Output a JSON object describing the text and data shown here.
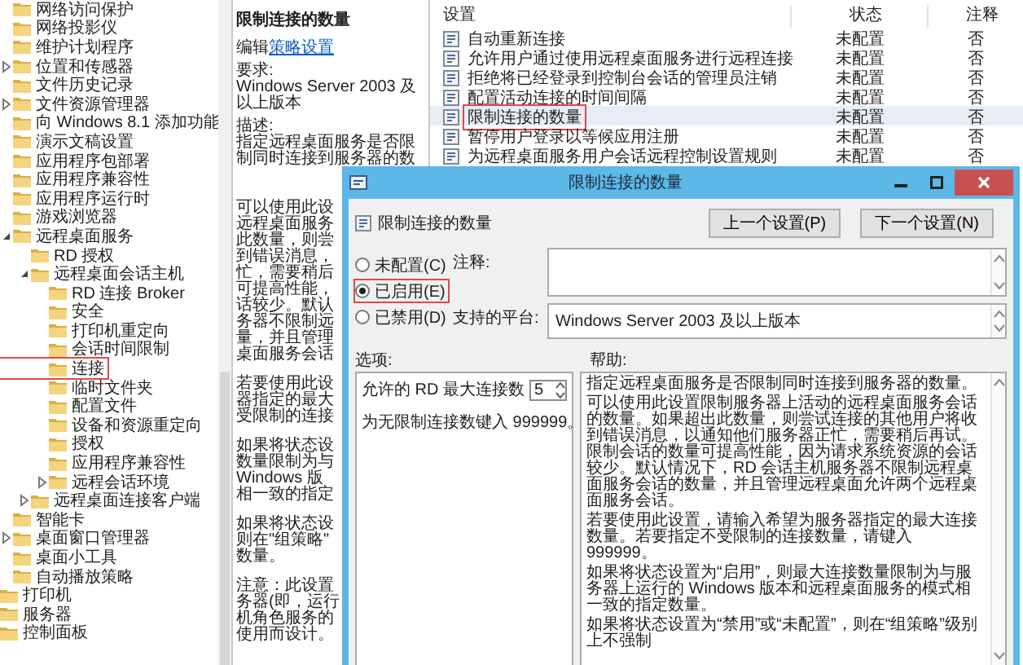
{
  "tree": {
    "items": [
      {
        "label": "网络访问保护",
        "kind": "leaf",
        "highlighted": false
      },
      {
        "label": "网络投影仪",
        "kind": "leaf",
        "highlighted": false
      },
      {
        "label": "维护计划程序",
        "kind": "leaf",
        "highlighted": false
      },
      {
        "label": "位置和传感器",
        "kind": "collapsed",
        "highlighted": false
      },
      {
        "label": "文件历史记录",
        "kind": "leaf",
        "highlighted": false
      },
      {
        "label": "文件资源管理器",
        "kind": "collapsed",
        "highlighted": false
      },
      {
        "label": "向 Windows 8.1 添加功能",
        "kind": "leaf",
        "highlighted": false
      },
      {
        "label": "演示文稿设置",
        "kind": "leaf",
        "highlighted": false
      },
      {
        "label": "应用程序包部署",
        "kind": "leaf",
        "highlighted": false
      },
      {
        "label": "应用程序兼容性",
        "kind": "leaf",
        "highlighted": false
      },
      {
        "label": "应用程序运行时",
        "kind": "leaf",
        "highlighted": false
      },
      {
        "label": "游戏浏览器",
        "kind": "leaf",
        "highlighted": false
      },
      {
        "label": "远程桌面服务",
        "kind": "expanded",
        "highlighted": false,
        "children": [
          {
            "label": "RD 授权",
            "kind": "leaf",
            "highlighted": false
          },
          {
            "label": "远程桌面会话主机",
            "kind": "expanded",
            "highlighted": false,
            "children": [
              {
                "label": "RD 连接 Broker",
                "kind": "leaf",
                "highlighted": false
              },
              {
                "label": "安全",
                "kind": "leaf",
                "highlighted": false
              },
              {
                "label": "打印机重定向",
                "kind": "leaf",
                "highlighted": false
              },
              {
                "label": "会话时间限制",
                "kind": "leaf",
                "highlighted": false
              },
              {
                "label": "连接",
                "kind": "leaf",
                "highlighted": true
              },
              {
                "label": "临时文件夹",
                "kind": "leaf",
                "highlighted": false
              },
              {
                "label": "配置文件",
                "kind": "leaf",
                "highlighted": false
              },
              {
                "label": "设备和资源重定向",
                "kind": "leaf",
                "highlighted": false
              },
              {
                "label": "授权",
                "kind": "leaf",
                "highlighted": false
              },
              {
                "label": "应用程序兼容性",
                "kind": "leaf",
                "highlighted": false
              },
              {
                "label": "远程会话环境",
                "kind": "collapsed",
                "highlighted": false
              }
            ]
          },
          {
            "label": "远程桌面连接客户端",
            "kind": "collapsed",
            "highlighted": false
          }
        ]
      },
      {
        "label": "智能卡",
        "kind": "leaf",
        "highlighted": false
      },
      {
        "label": "桌面窗口管理器",
        "kind": "collapsed",
        "highlighted": false
      },
      {
        "label": "桌面小工具",
        "kind": "leaf",
        "highlighted": false
      },
      {
        "label": "自动播放策略",
        "kind": "leaf",
        "highlighted": false
      }
    ],
    "parent_items": [
      {
        "label": "打印机",
        "highlighted": false
      },
      {
        "label": "服务器",
        "highlighted": false
      },
      {
        "label": "控制面板",
        "highlighted": false
      }
    ]
  },
  "description": {
    "title": "限制连接的数量",
    "edit_prefix": "编辑",
    "edit_link": "策略设置",
    "requirement_label": "要求:",
    "requirement": "Windows Server 2003 及以上版本",
    "description_label": "描述:",
    "summary": "指定远程桌面服务是否限制同时连接到服务器的数",
    "paragraphs": [
      [
        "可以使用此设",
        "远程桌面服务",
        "此数量，则尝",
        "到错误消息，",
        "忙，需要稍后",
        "可提高性能，",
        "话较少。默认",
        "务器不限制远",
        "量，并且管理",
        "桌面服务会话"
      ],
      [
        "若要使用此设",
        "器指定的最大",
        "受限制的连接"
      ],
      [
        "如果将状态设",
        "数量限制为与",
        "Windows 版",
        "相一致的指定"
      ],
      [
        "如果将状态设",
        "则在\"组策略\"",
        "数量。"
      ],
      [
        "注意：此设置",
        "务器(即，运行",
        "机角色服务的",
        "使用而设计。"
      ]
    ]
  },
  "policy_list": {
    "columns": [
      "设置",
      "状态",
      "注释"
    ],
    "rows": [
      {
        "setting": "自动重新连接",
        "state": "未配置",
        "comment": "否",
        "selected": false,
        "highlighted": false
      },
      {
        "setting": "允许用户通过使用远程桌面服务进行远程连接",
        "state": "未配置",
        "comment": "否",
        "selected": false,
        "highlighted": false
      },
      {
        "setting": "拒绝将已经登录到控制台会话的管理员注销",
        "state": "未配置",
        "comment": "否",
        "selected": false,
        "highlighted": false
      },
      {
        "setting": "配置活动连接的时间间隔",
        "state": "未配置",
        "comment": "否",
        "selected": false,
        "highlighted": false
      },
      {
        "setting": "限制连接的数量",
        "state": "未配置",
        "comment": "否",
        "selected": true,
        "highlighted": true
      },
      {
        "setting": "暂停用户登录以等候应用注册",
        "state": "未配置",
        "comment": "否",
        "selected": false,
        "highlighted": false
      },
      {
        "setting": "为远程桌面服务用户会话远程控制设置规则",
        "state": "未配置",
        "comment": "否",
        "selected": false,
        "highlighted": false
      }
    ]
  },
  "dialog": {
    "title": "限制连接的数量",
    "setting_name": "限制连接的数量",
    "buttons": [
      "上一个设置(P)",
      "下一个设置(N)"
    ],
    "states": [
      {
        "label": "未配置(C)",
        "selected": false,
        "highlighted": false
      },
      {
        "label": "已启用(E)",
        "selected": true,
        "highlighted": true
      },
      {
        "label": "已禁用(D)",
        "selected": false,
        "highlighted": false
      }
    ],
    "comment_label": "注释:",
    "platform_label": "支持的平台:",
    "platform": "Windows Server 2003 及以上版本",
    "options_label": "选项:",
    "help_label": "帮助:",
    "option": {
      "label": "允许的 RD 最大连接数",
      "value": "5"
    },
    "option_hint": "为无限制连接数键入 999999。",
    "help": [
      "指定远程桌面服务是否限制同时连接到服务器的数量。",
      "可以使用此设置限制服务器上活动的远程桌面服务会话的数量。如果超出此数量，则尝试连接的其他用户将收到错误消息，以通知他们服务器正忙，需要稍后再试。限制会话的数量可提高性能，因为请求系统资源的会话较少。默认情况下，RD 会话主机服务器不限制远程桌面服务会话的数量，并且管理远程桌面允许两个远程桌面服务会话。",
      "若要使用此设置，请输入希望为服务器指定的最大连接数量。若要指定不受限制的连接数量，请键入 999999。",
      "如果将状态设置为“启用”，则最大连接数量限制为与服务器上运行的 Windows 版本和远程桌面服务的模式相一致的指定数量。",
      "如果将状态设置为“禁用”或“未配置”，则在“组策略”级别上不强制"
    ]
  }
}
